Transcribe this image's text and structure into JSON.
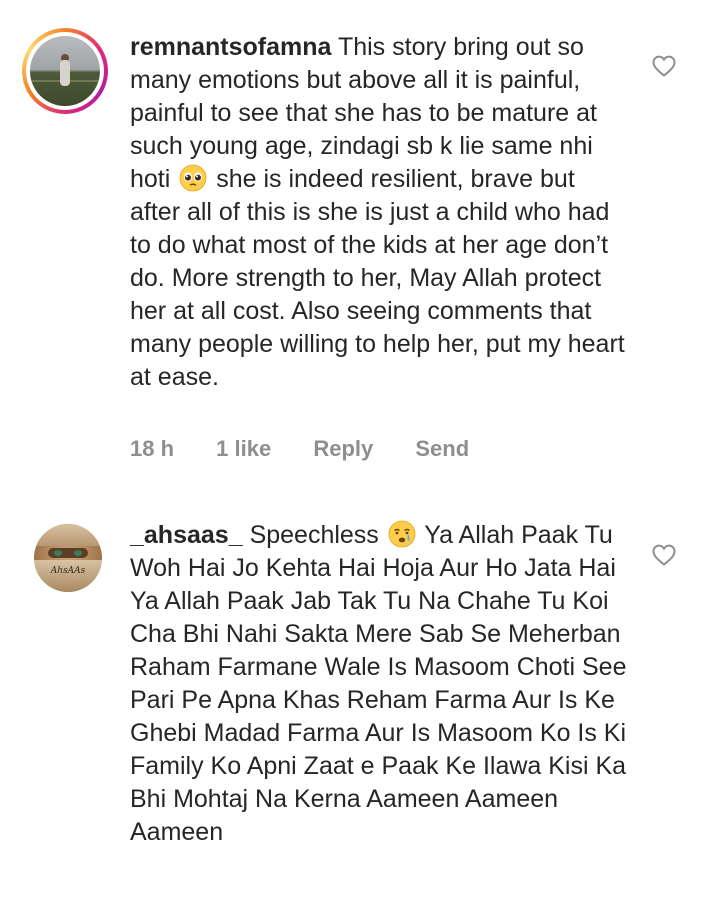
{
  "comments": [
    {
      "username": "remnantsofamna",
      "text_before_emoji": "This story bring out so many emotions but above all it is painful, painful to see that she has to be mature at such young age, zindagi sb k lie same nhi hoti",
      "emoji": "pleading-face",
      "text_after_emoji": "she is indeed resilient, brave but after all of this is she is just a child who had to do what most of the kids at her age don’t do. More strength to her, May Allah protect her at all cost. Also seeing comments that many people willing to help her, put my heart at ease.",
      "time": "18 h",
      "likes": "1 like",
      "reply_label": "Reply",
      "send_label": "Send",
      "avatar_icon": "avatar-story-ring"
    },
    {
      "username": "_ahsaas_",
      "text_before_emoji": "Speechless",
      "emoji": "crying-face",
      "text_after_emoji": "Ya Allah Paak Tu Woh Hai Jo Kehta Hai Hoja Aur Ho Jata Hai Ya Allah Paak Jab Tak Tu Na Chahe Tu Koi Cha Bhi Nahi Sakta Mere Sab Se Meherban Raham Farmane Wale Is Masoom Choti See Pari Pe Apna Khas Reham Farma Aur Is Ke Ghebi Madad Farma Aur Is Masoom Ko Is Ki Family Ko Apni Zaat e Paak Ke Ilawa Kisi Ka Bhi Mohtaj Na Kerna Aameen Aameen Aameen",
      "avatar_text": "AhsAAs"
    }
  ],
  "colors": {
    "text": "#262626",
    "meta": "#8e8e8e",
    "heart_stroke": "#8e8e8e",
    "story_ring_start": "#f58529",
    "story_ring_end": "#dd2a7b"
  }
}
